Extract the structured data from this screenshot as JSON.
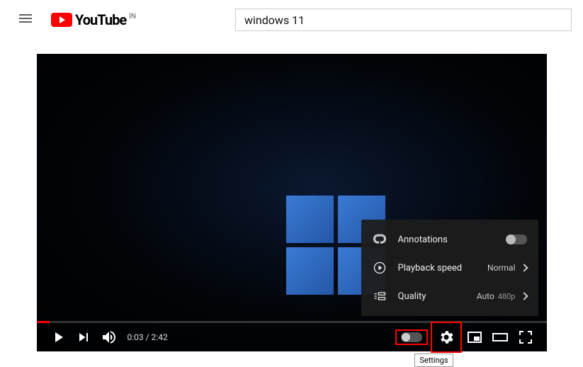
{
  "header": {
    "logo_text": "YouTube",
    "country_code": "IN",
    "search_value": "windows 11"
  },
  "player": {
    "current_time": "0:03",
    "duration": "2:42",
    "time_display": "0:03 / 2:42"
  },
  "settings_menu": {
    "annotations": {
      "label": "Annotations"
    },
    "playback": {
      "label": "Playback speed",
      "value": "Normal"
    },
    "quality": {
      "label": "Quality",
      "value": "Auto",
      "sub": "480p"
    }
  },
  "tooltip": {
    "settings": "Settings"
  }
}
